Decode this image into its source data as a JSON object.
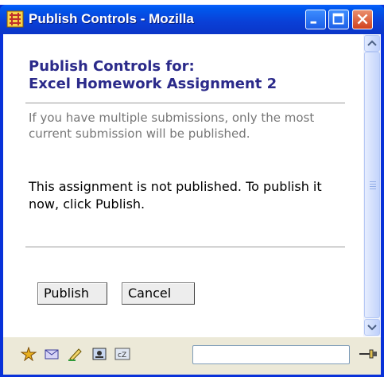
{
  "window": {
    "title": "Publish Controls - Mozilla"
  },
  "heading": {
    "line1": "Publish Controls for:",
    "line2": "Excel Homework Assignment 2"
  },
  "note": "If you have multiple submissions, only the most current submission will be published.",
  "status_message": "This assignment is not published. To publish it now, click Publish.",
  "buttons": {
    "publish": "Publish",
    "cancel": "Cancel"
  },
  "statusbar": {
    "icons": [
      "navigator-icon",
      "mail-icon",
      "composer-icon",
      "address-book-icon",
      "chatzilla-icon"
    ],
    "url_value": ""
  },
  "colors": {
    "title_bar": "#0a3fd6",
    "heading": "#2b2a8a",
    "note_text": "#777777",
    "close_button": "#d1421e"
  }
}
